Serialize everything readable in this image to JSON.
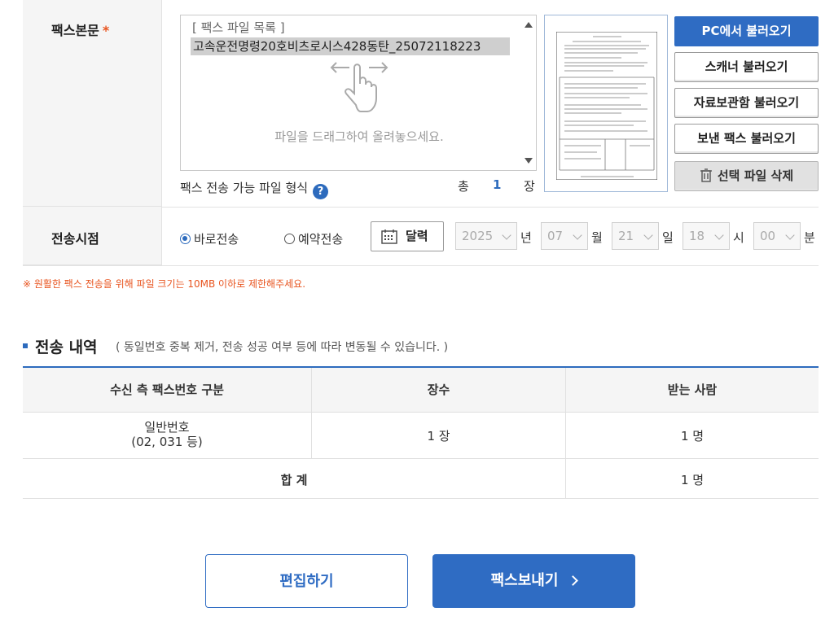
{
  "fax_body": {
    "label": "팩스본문",
    "required_mark": "*",
    "list_title": "[ 팩스 파일 목록 ]",
    "files": [
      "고속운전명령20호비츠로시스428동탄_25072118223"
    ],
    "drag_hint": "파일을 드래그하여 올려놓으세요.",
    "format_label": "팩스 전송 가능 파일 형식",
    "help_icon_text": "?",
    "total_label": "총",
    "total_count": "1",
    "total_unit": "장",
    "preview_icon": "document-preview-icon"
  },
  "side_buttons": {
    "pc_load": "PC에서 불러오기",
    "scanner_load": "스캐너 불러오기",
    "archive_load": "자료보관함 불러오기",
    "sent_load": "보낸 팩스 불러오기",
    "delete_selected": "선택 파일 삭제"
  },
  "send_time": {
    "label": "전송시점",
    "immediate": "바로전송",
    "scheduled": "예약전송",
    "selected": "immediate",
    "calendar_button": "달력",
    "year": "2025",
    "year_unit": "년",
    "month": "07",
    "month_unit": "월",
    "day": "21",
    "day_unit": "일",
    "hour": "18",
    "hour_unit": "시",
    "minute": "00",
    "minute_unit": "분"
  },
  "notice": "※ 원활한 팩스 전송을 위해 파일 크기는 10MB 이하로 제한해주세요.",
  "history": {
    "title": "전송 내역",
    "subtitle": "( 동일번호 중복 제거, 전송 성공 여부 등에 따라 변동될 수 있습니다. )",
    "columns": [
      "수신 측 팩스번호 구분",
      "장수",
      "받는 사람"
    ],
    "rows": [
      {
        "type_line1": "일반번호",
        "type_line2": "(02, 031 등)",
        "pages": "1 장",
        "recipients": "1 명"
      }
    ],
    "total_label": "합 계",
    "total_recipients": "1 명"
  },
  "actions": {
    "edit": "편집하기",
    "send": "팩스보내기"
  },
  "colors": {
    "primary": "#2f6cc3",
    "accent": "#e8541f",
    "label_bg": "#f5f5f5"
  }
}
